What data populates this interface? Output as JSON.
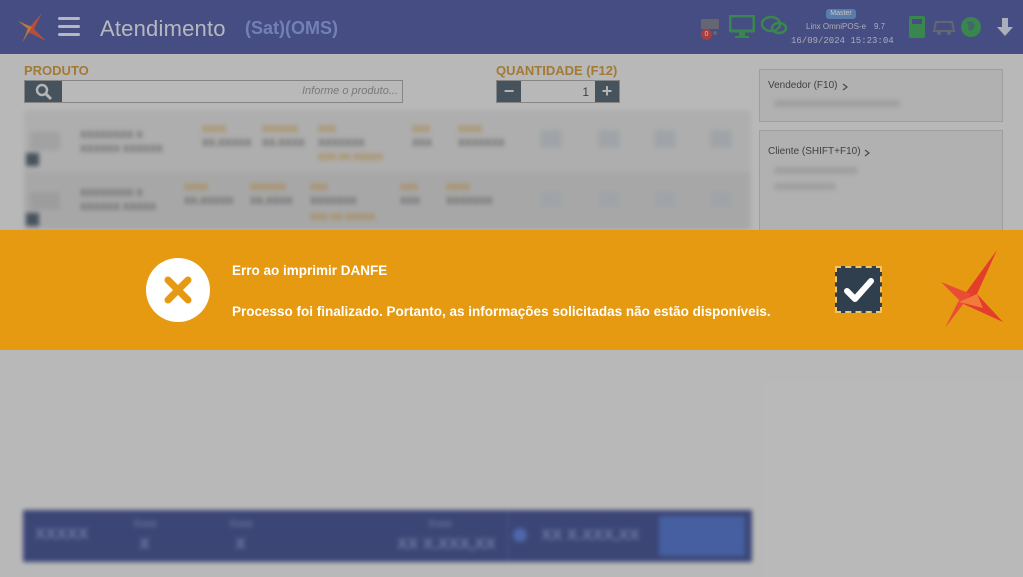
{
  "header": {
    "app_title": "Atendimento",
    "app_mode": "(Sat)(OMS)",
    "cart_badge": "0",
    "role_badge": "Master",
    "device_name": "Linx OmniPOS-e",
    "device_version": "9.7",
    "datetime": "16/09/2024 15:23:04",
    "icons": [
      "logo-icon",
      "menu-icon",
      "cart-icon",
      "monitor-icon",
      "chat-icon",
      "calculator-icon",
      "delivery-icon",
      "globe-icon",
      "arrow-down-icon"
    ]
  },
  "product": {
    "label": "PRODUTO",
    "search_placeholder": "Informe o produto..."
  },
  "quantity": {
    "label": "QUANTIDADE (F12)",
    "value": "1",
    "minus": "−",
    "plus": "+"
  },
  "sidebar": {
    "seller_label": "Vendedor (F10)",
    "client_label": "Cliente (SHIFT+F10)"
  },
  "error": {
    "title": "Erro ao imprimir DANFE",
    "message": "Processo foi finalizado. Portanto, as informações solicitadas não estão disponíveis."
  },
  "colors": {
    "header_bg": "#3d4798",
    "banner_bg": "#e59a12",
    "accent_orange": "#c98b22",
    "ok_button_bg": "#2f3f4e"
  }
}
